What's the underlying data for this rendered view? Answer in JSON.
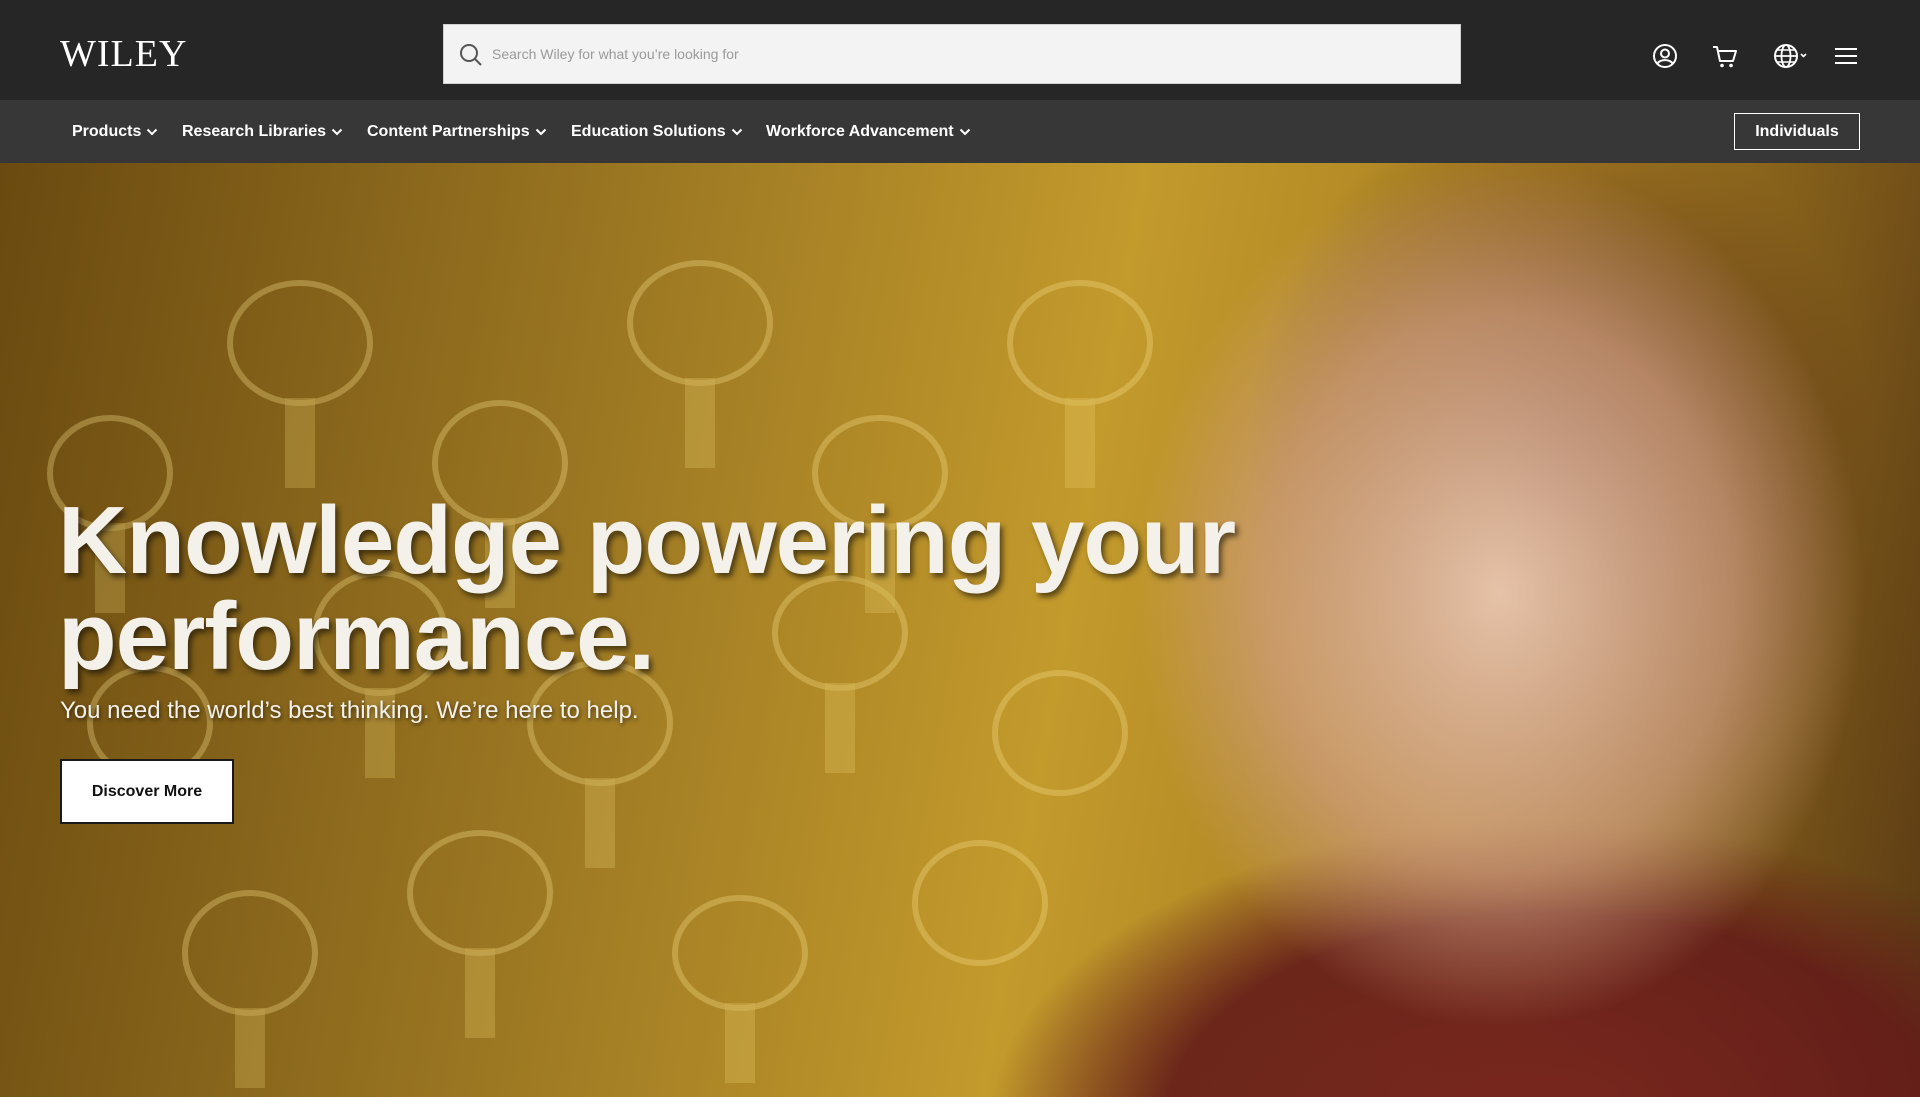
{
  "header": {
    "logo_text": "Wiley",
    "search": {
      "placeholder": "Search Wiley for what you’re looking for",
      "value": ""
    },
    "icons": [
      "user-circle-icon",
      "cart-icon",
      "globe-icon",
      "hamburger-menu-icon"
    ]
  },
  "nav": {
    "items": [
      {
        "label": "Products"
      },
      {
        "label": "Research Libraries"
      },
      {
        "label": "Content Partnerships"
      },
      {
        "label": "Education Solutions"
      },
      {
        "label": "Workforce Advancement"
      }
    ],
    "individuals_label": "Individuals"
  },
  "hero": {
    "title": "Knowledge powering your performance.",
    "subtitle": "You need the world’s best thinking. We’re here to help.",
    "cta_label": "Discover More"
  },
  "colors": {
    "header_bg": "#262626",
    "nav_bg": "#373737",
    "text_light": "#ffffff",
    "hero_gold": "#c39a2c"
  }
}
